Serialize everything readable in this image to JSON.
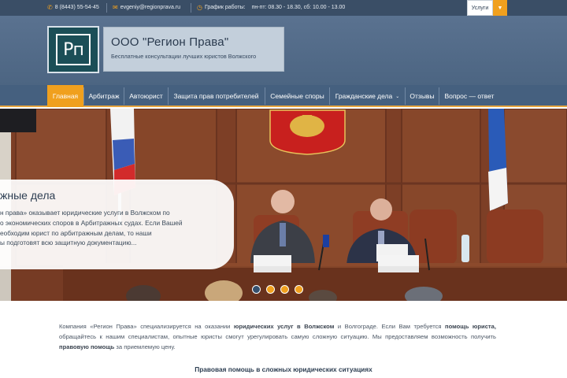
{
  "topbar": {
    "phone": "8 (8443) 55-54-45",
    "email": "evgeniy@regionprava.ru",
    "schedule_label": "График работы:",
    "schedule_value": "пн-пт: 08.30 - 18.30, сб: 10.00 - 13.00",
    "services_label": "Услуги",
    "icons": {
      "phone": "phone-icon",
      "email": "mail-icon",
      "schedule": "clock-icon",
      "services": "chevron-down-icon"
    }
  },
  "header": {
    "logo_text": "Рп",
    "company_name": "ООО \"Регион Права\"",
    "slogan": "Бесплатные консультации лучших юристов Волжского"
  },
  "nav": {
    "items": [
      {
        "label": "Главная",
        "active": true
      },
      {
        "label": "Арбитраж"
      },
      {
        "label": "Автоюрист"
      },
      {
        "label": "Защита прав потребителей"
      },
      {
        "label": "Семейные споры"
      },
      {
        "label": "Гражданские дела"
      },
      {
        "label": "Отзывы"
      },
      {
        "label": "Вопрос — ответ"
      }
    ]
  },
  "hero": {
    "title": "жные дела",
    "lines": [
      "н права» оказывает юридические услуги в Волжском по",
      "о экономических споров в Арбитражных судах. Если Вашей",
      "еобходим юрист по арбитражным делам, то наши",
      "ы подготовят всю защитную документацию..."
    ],
    "slides_count": 4,
    "active_slide": 1
  },
  "content": {
    "intro_parts": [
      {
        "text": "Компания «Регион Права» специализируется на оказании ",
        "bold": false
      },
      {
        "text": "юридических услуг в Волжском",
        "bold": true
      },
      {
        "text": " и Волгограде. Если Вам требуется ",
        "bold": false
      },
      {
        "text": "помощь юриста,",
        "bold": true
      },
      {
        "text": " обращайтесь к нашим специалистам, опытные юристы смогут урегулировать самую сложную ситуацию. Мы предоставляем возможность получить ",
        "bold": false
      },
      {
        "text": "правовую помощь",
        "bold": true
      },
      {
        "text": " за приемлемую цену.",
        "bold": false
      }
    ],
    "subheading": "Правовая помощь в сложных юридических ситуациях"
  },
  "colors": {
    "accent": "#f0a01e",
    "nav_bg": "#45607f",
    "header_bg": "#5a7290",
    "topbar_bg": "#3a4e66"
  }
}
